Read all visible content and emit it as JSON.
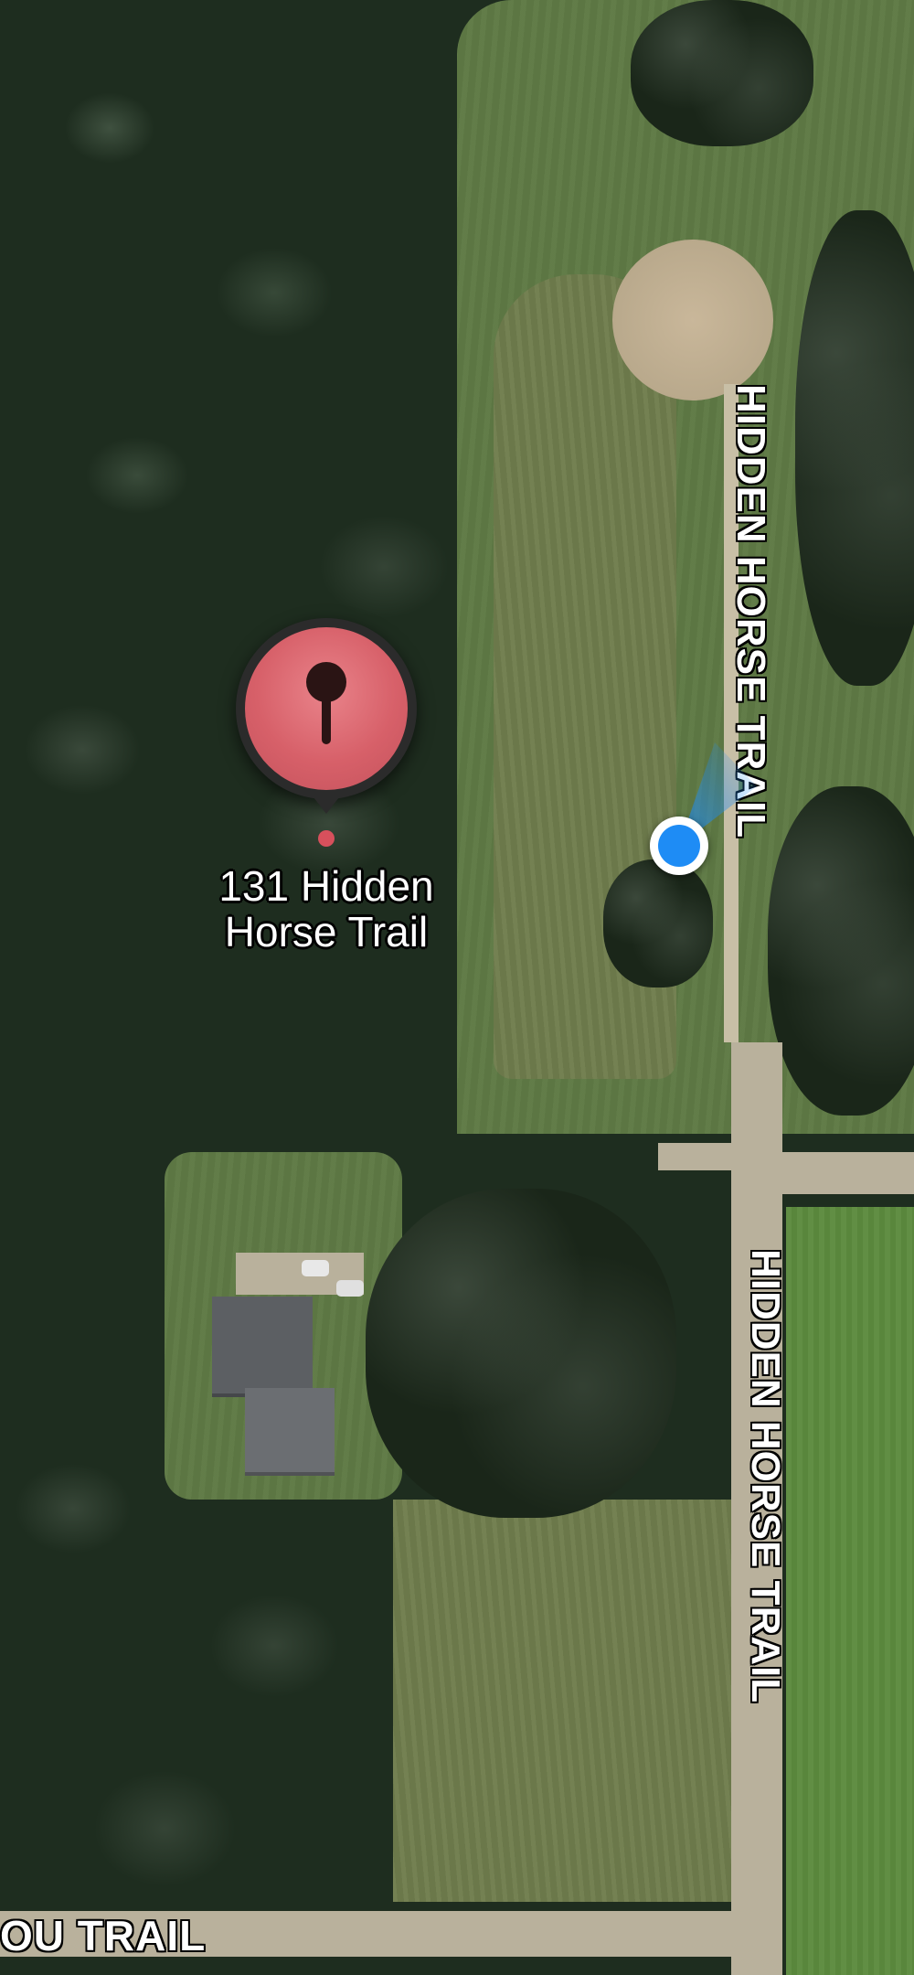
{
  "map": {
    "view": "satellite",
    "streets": [
      {
        "id": "hidden-horse-trail-north",
        "name": "HIDDEN HORSE TRAIL"
      },
      {
        "id": "hidden-horse-trail-south",
        "name": "HIDDEN HORSE TRAIL"
      },
      {
        "id": "bayou-trail",
        "name": "OU TRAIL"
      }
    ],
    "pin": {
      "label": "131 Hidden Horse Trail",
      "label_line1": "131 Hidden",
      "label_line2": "Horse Trail",
      "icon": "map-pin-icon",
      "color": "#d7606a"
    },
    "current_location": {
      "icon": "current-location-dot",
      "color": "#1e8cf5",
      "heading_beam": true
    }
  }
}
